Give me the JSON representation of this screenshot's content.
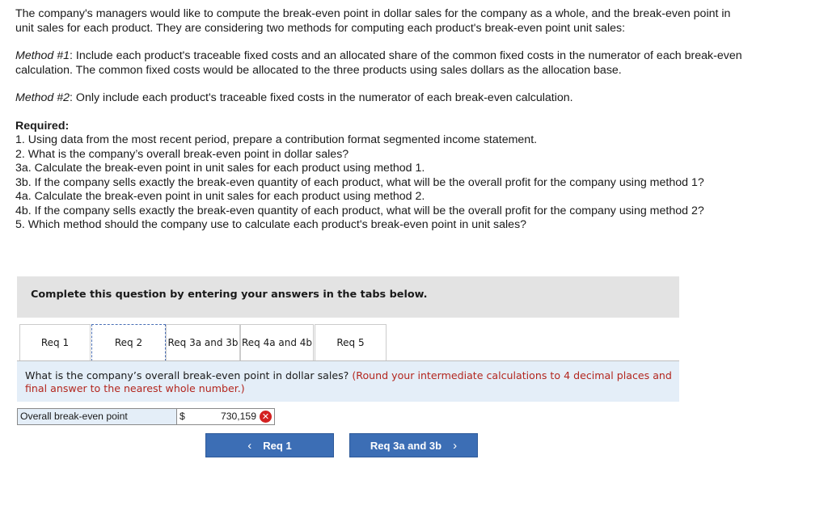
{
  "intro": {
    "paragraph1": "The company's managers would like to compute the break-even point in dollar sales for the company as a whole, and the break-even point in unit sales for each product. They are considering two methods for computing each product's break-even point unit sales:",
    "method1_label": "Method #1",
    "method1_text": ": Include each product's traceable fixed costs and an allocated share of the common fixed costs in the numerator of each break-even calculation. The common fixed costs would be allocated to the three products using sales dollars as the allocation base.",
    "method2_label": "Method #2",
    "method2_text": ": Only include each product's traceable fixed costs in the numerator of each break-even calculation.",
    "required_title": "Required:",
    "requirements": [
      "1. Using data from the most recent period, prepare a contribution format segmented income statement.",
      "2. What is the company’s overall break-even point in dollar sales?",
      "3a. Calculate the break-even point in unit sales for each product using method 1.",
      "3b. If the company sells exactly the break-even quantity of each product, what will be the overall profit for the company using method 1?",
      "4a. Calculate the break-even point in unit sales for each product using method 2.",
      "4b. If the company sells exactly the break-even quantity of each product, what will be the overall profit for the company using method 2?",
      "5. Which method should the company use to calculate each product's break-even point in unit sales?"
    ]
  },
  "prompt": "Complete this question by entering your answers in the tabs below.",
  "tabs": [
    {
      "label": "Req 1"
    },
    {
      "label": "Req 2"
    },
    {
      "label": "Req 3a and 3b"
    },
    {
      "label": "Req 4a and 4b"
    },
    {
      "label": "Req 5"
    }
  ],
  "active_tab": "Req 2",
  "question": {
    "text": "What is the company’s overall break-even point in dollar sales?",
    "hint": "(Round your intermediate calculations to 4 decimal places and final answer to the nearest whole number.)"
  },
  "answer": {
    "label": "Overall break-even point",
    "currency": "$",
    "value": "730,159",
    "status_icon": "incorrect-x-icon"
  },
  "nav": {
    "prev_label": "Req 1",
    "next_label": "Req 3a and 3b",
    "prev_icon": "‹",
    "next_icon": "›"
  },
  "colors": {
    "accent": "#3c6eb5",
    "hint": "#b3261e",
    "error": "#d32020",
    "question_bg": "#e4eef8",
    "prompt_bg": "#e3e3e3"
  }
}
